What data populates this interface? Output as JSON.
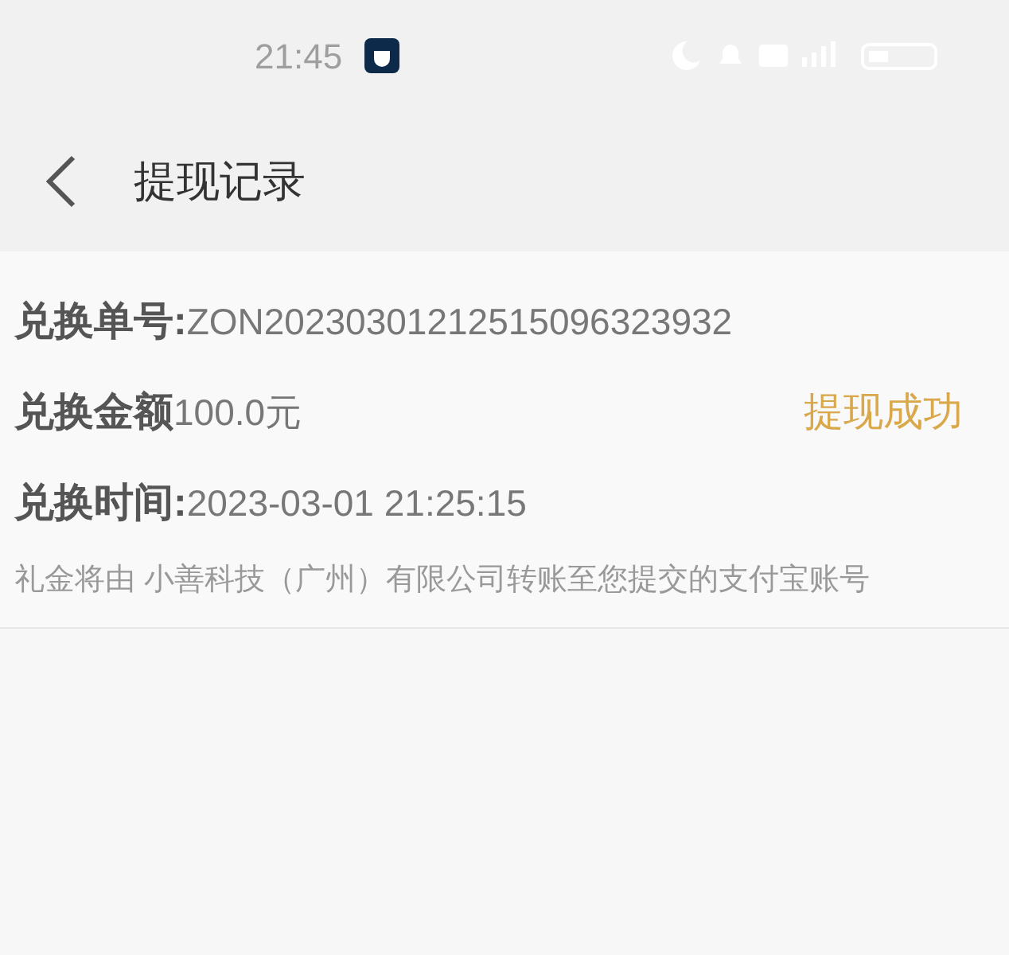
{
  "status_bar": {
    "time": "21:45"
  },
  "header": {
    "title": "提现记录"
  },
  "record": {
    "fields": [
      {
        "label": "兑换单号:",
        "value": "ZON20230301212515096323932"
      },
      {
        "label": "兑换金额",
        "value": "100.0元",
        "status": "提现成功"
      },
      {
        "label": "兑换时间:",
        "value": "2023-03-01 21:25:15"
      }
    ],
    "note": "礼金将由 小善科技（广州）有限公司转账至您提交的支付宝账号"
  }
}
